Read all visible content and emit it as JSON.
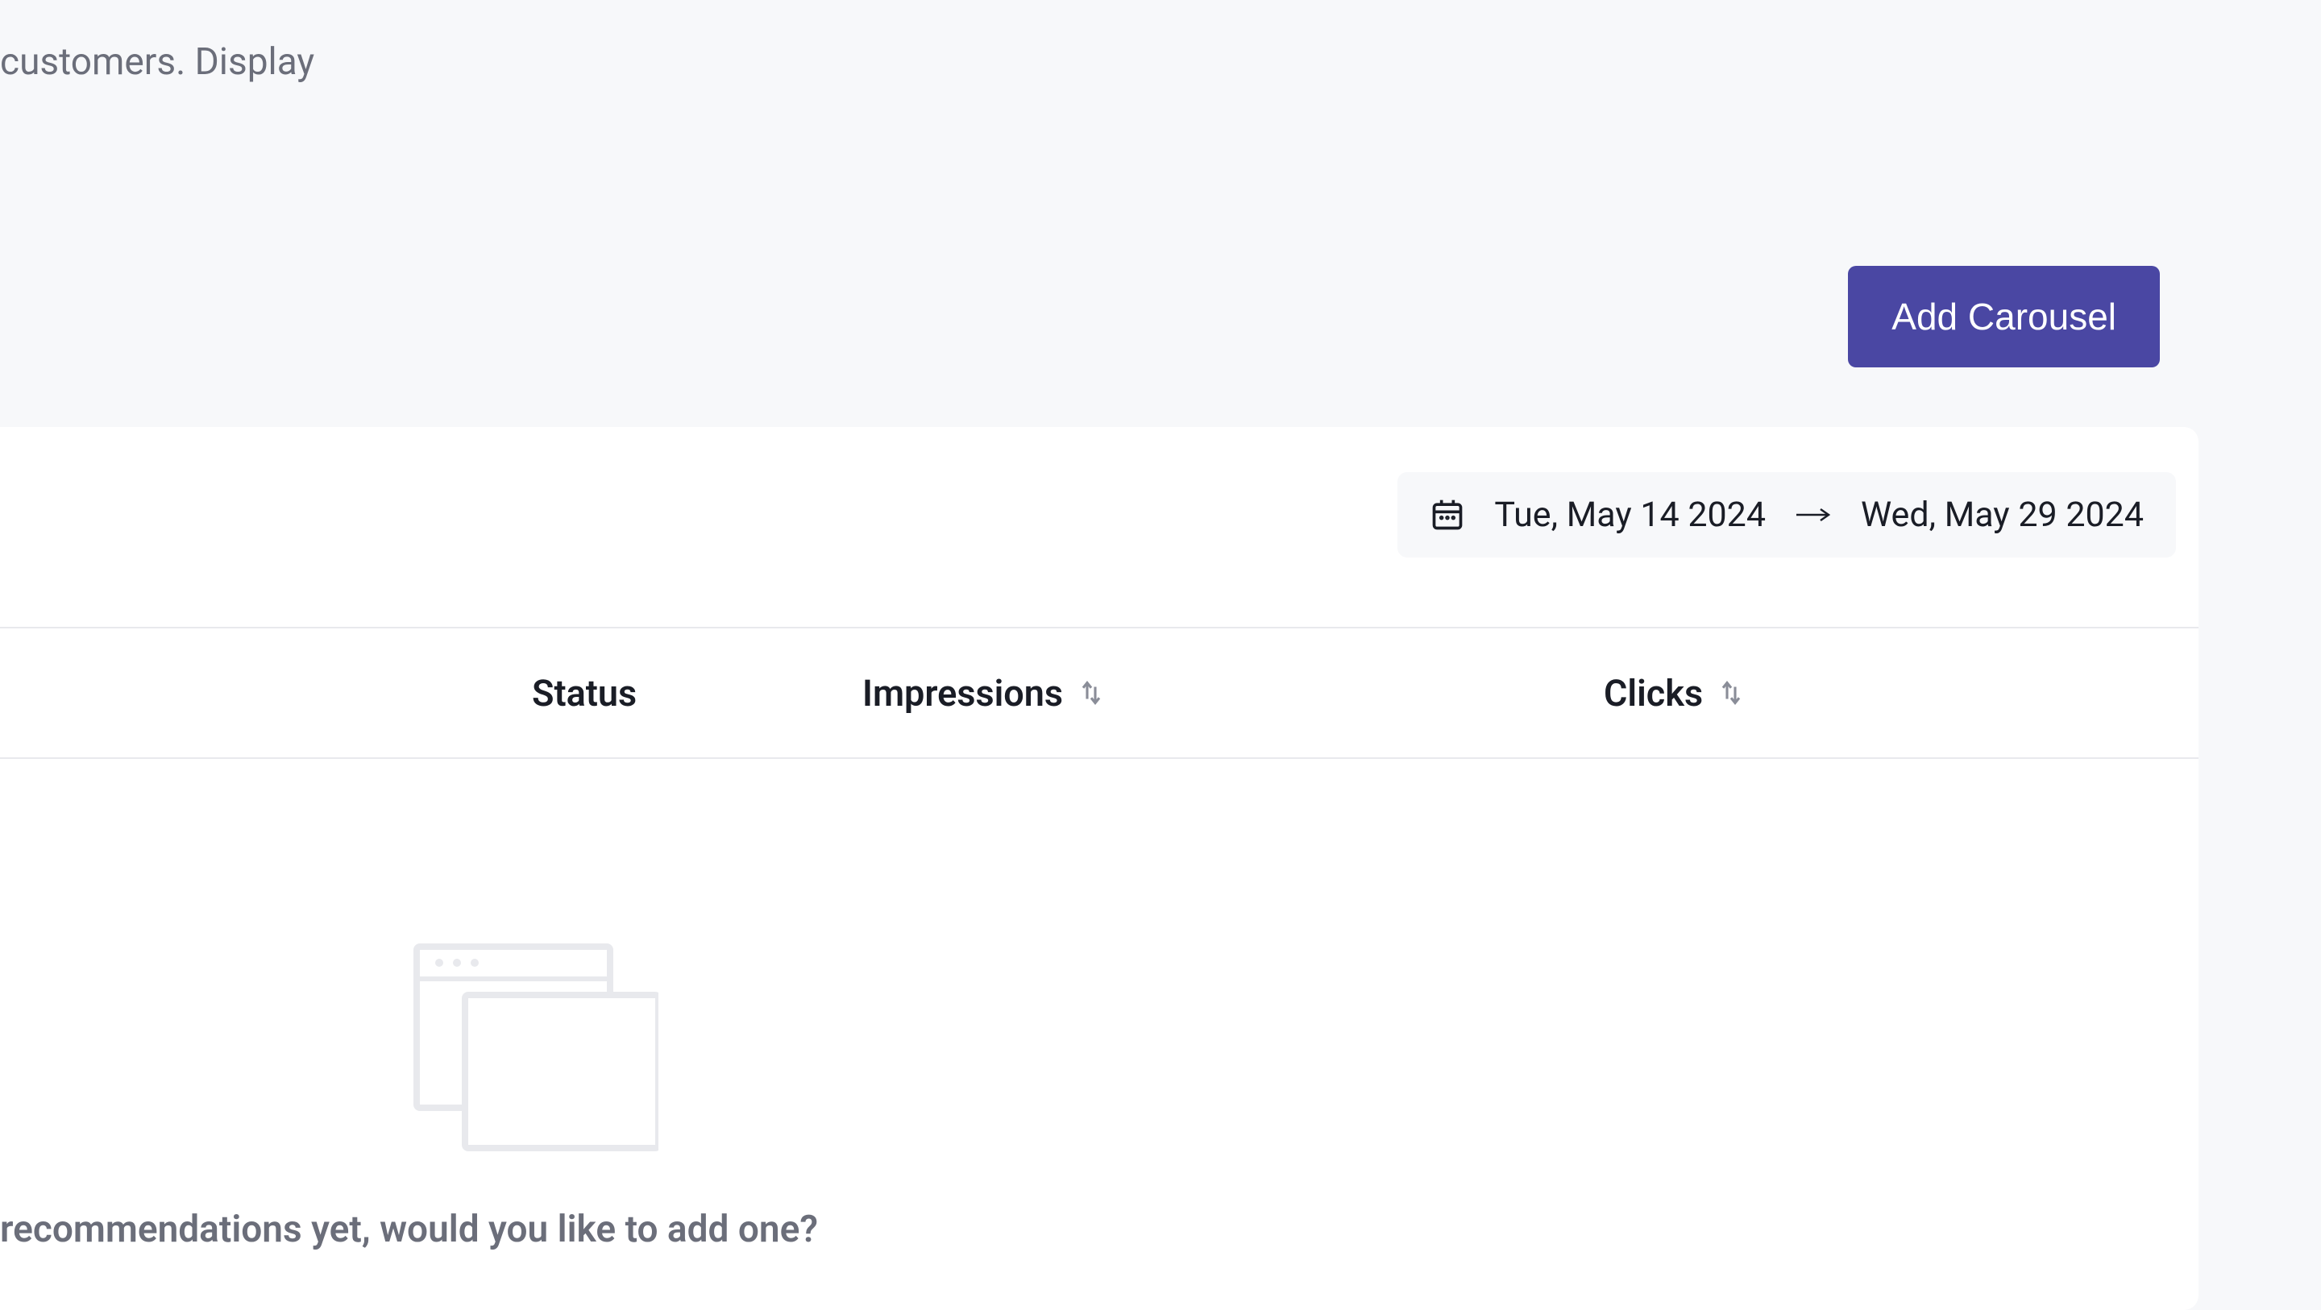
{
  "header": {
    "description_fragment": "customers. Display"
  },
  "actions": {
    "add_carousel_label": "Add Carousel"
  },
  "date_range": {
    "start": "Tue, May 14 2024",
    "end": "Wed, May 29 2024"
  },
  "table": {
    "columns": {
      "status": "Status",
      "impressions": "Impressions",
      "clicks": "Clicks"
    }
  },
  "empty_state": {
    "message": "recommendations yet, would you like to add one?"
  }
}
